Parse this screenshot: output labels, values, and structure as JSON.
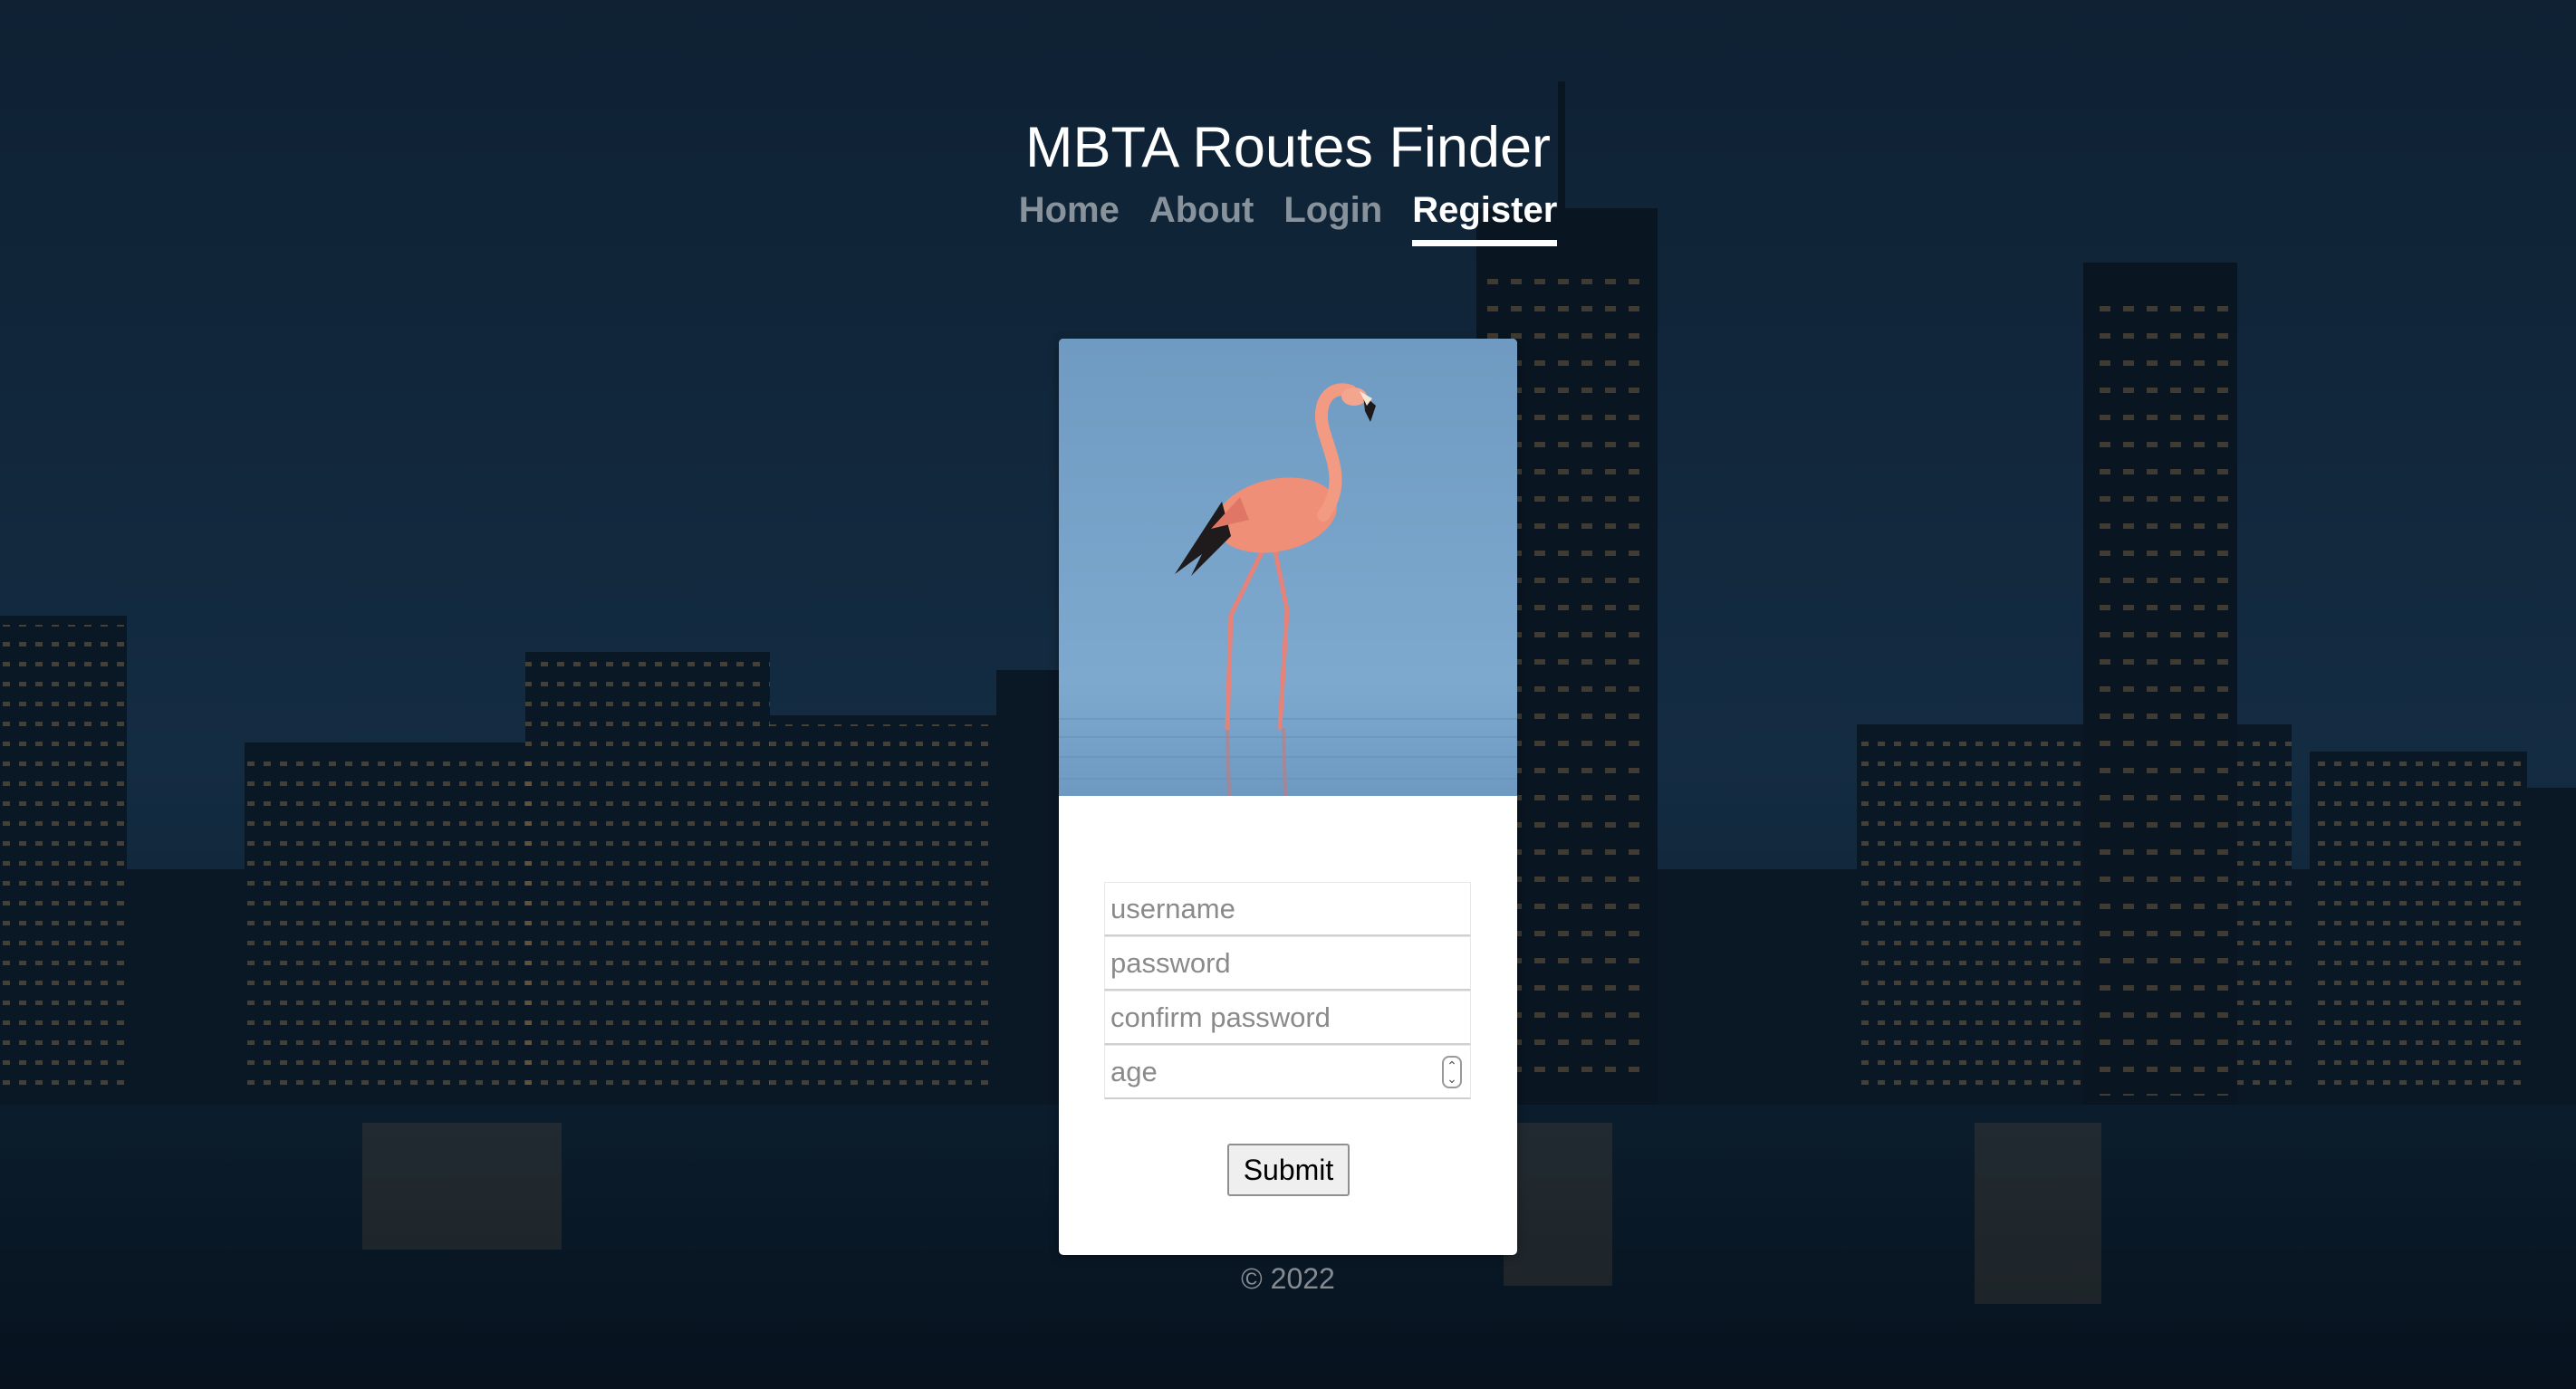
{
  "header": {
    "title": "MBTA Routes Finder"
  },
  "nav": {
    "items": [
      {
        "label": "Home",
        "active": false
      },
      {
        "label": "About",
        "active": false
      },
      {
        "label": "Login",
        "active": false
      },
      {
        "label": "Register",
        "active": true
      }
    ]
  },
  "card": {
    "image": "flamingo-standing-in-water",
    "form": {
      "username_placeholder": "username",
      "password_placeholder": "password",
      "confirm_password_placeholder": "confirm password",
      "age_placeholder": "age",
      "submit_label": "Submit"
    }
  },
  "footer": {
    "copyright": "© 2022"
  }
}
